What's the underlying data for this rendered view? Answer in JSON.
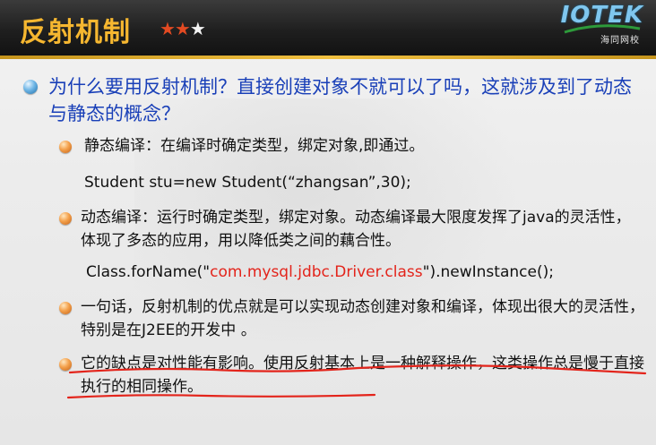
{
  "header": {
    "title": "反射机制",
    "stars": {
      "filled": "★★",
      "empty": "★",
      "filled_color": "#e34a22",
      "empty_color": "#f3f3f3"
    },
    "logo": {
      "name": "IOTEK",
      "subtitle": "海同网校"
    }
  },
  "content": {
    "main_bullet": "为什么要用反射机制？直接创建对象不就可以了吗，这就涉及到了动态与静态的概念？",
    "static": {
      "label": "静态编译：在编译时确定类型，绑定对象,即通过。",
      "code": "Student stu=new Student(“zhangsan”,30);"
    },
    "dynamic": {
      "label": "动态编译：运行时确定类型，绑定对象。动态编译最大限度发挥了java的灵活性，体现了多态的应用，用以降低类之间的藕合性。",
      "code_prefix": "Class.forName(\"",
      "code_string": "com.mysql.jdbc.Driver.class",
      "code_suffix": "\").newInstance();"
    },
    "advantage": "一句话，反射机制的优点就是可以实现动态创建对象和编译，体现出很大的灵活性，特别是在J2EE的开发中 。",
    "disadvantage": "它的缺点是对性能有影响。使用反射基本上是一种解释操作，这类操作总是慢于直接执行的相同操作。"
  },
  "colors": {
    "title": "#f6b730",
    "main_text": "#1a40b8",
    "code_string": "#e3241b",
    "annotation": "#e3241b"
  }
}
